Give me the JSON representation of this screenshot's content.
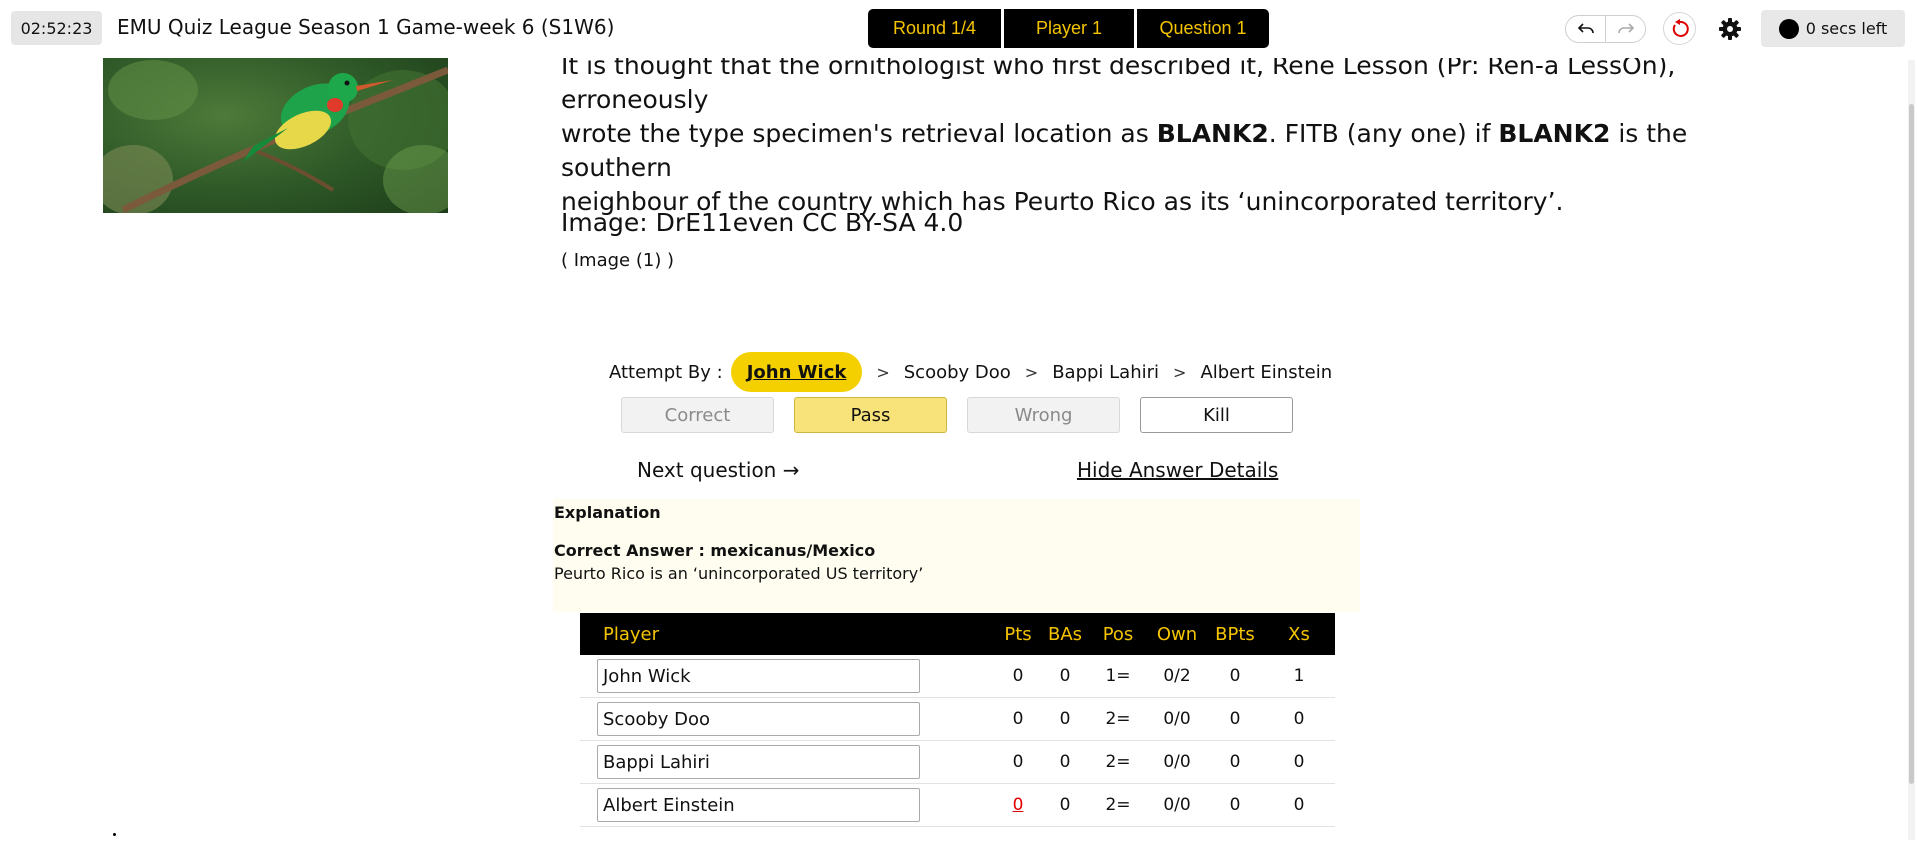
{
  "header": {
    "clock": "02:52:23",
    "title": "EMU Quiz League Season 1 Game-week 6 (S1W6)",
    "round_label": "Round 1/4",
    "player_label": "Player 1",
    "question_label": "Question 1",
    "timer_text": "0 secs left"
  },
  "question": {
    "line1": "It is thought that the ornithologist who first described it, Rene Lesson (Pr: Ren-a LessOn), erroneously",
    "line2_pre": "wrote the type specimen's retrieval location as ",
    "blank": "BLANK2",
    "line2_mid": ". FITB (any one) if ",
    "line2_post": " is the southern",
    "line3": "neighbour of the country which has Peurto Rico as its ‘unincorporated territory’.",
    "image_credit": "Image: DrE11even CC BY-SA 4.0",
    "image_link": "( Image (1) )"
  },
  "attempt": {
    "label": "Attempt By :",
    "current": "John Wick",
    "queue": [
      "Scooby Doo",
      "Bappi Lahiri",
      "Albert Einstein"
    ]
  },
  "verdicts": {
    "correct": "Correct",
    "pass": "Pass",
    "wrong": "Wrong",
    "kill": "Kill"
  },
  "nav": {
    "next_question": "Next question →",
    "hide_answer": "Hide Answer Details"
  },
  "explanation": {
    "heading": "Explanation",
    "correct_answer": "Correct Answer : mexicanus/Mexico",
    "note": "Peurto Rico is an ‘unincorporated US territory’"
  },
  "scoreboard": {
    "columns": [
      "Player",
      "Pts",
      "BAs",
      "Pos",
      "Own",
      "BPts",
      "Xs"
    ],
    "rows": [
      {
        "name": "John Wick",
        "pts": "0",
        "bas": "0",
        "pos": "1=",
        "own": "0/2",
        "bpts": "0",
        "xs": "1"
      },
      {
        "name": "Scooby Doo",
        "pts": "0",
        "bas": "0",
        "pos": "2=",
        "own": "0/0",
        "bpts": "0",
        "xs": "0"
      },
      {
        "name": "Bappi Lahiri",
        "pts": "0",
        "bas": "0",
        "pos": "2=",
        "own": "0/0",
        "bpts": "0",
        "xs": "0"
      },
      {
        "name": "Albert Einstein",
        "pts": "0",
        "bas": "0",
        "pos": "2=",
        "own": "0/0",
        "bpts": "0",
        "xs": "0"
      }
    ]
  },
  "colors": {
    "accent_yellow": "#f5d000",
    "header_bg": "#000000",
    "header_text": "#f5c400",
    "alert_red": "#e00000"
  }
}
